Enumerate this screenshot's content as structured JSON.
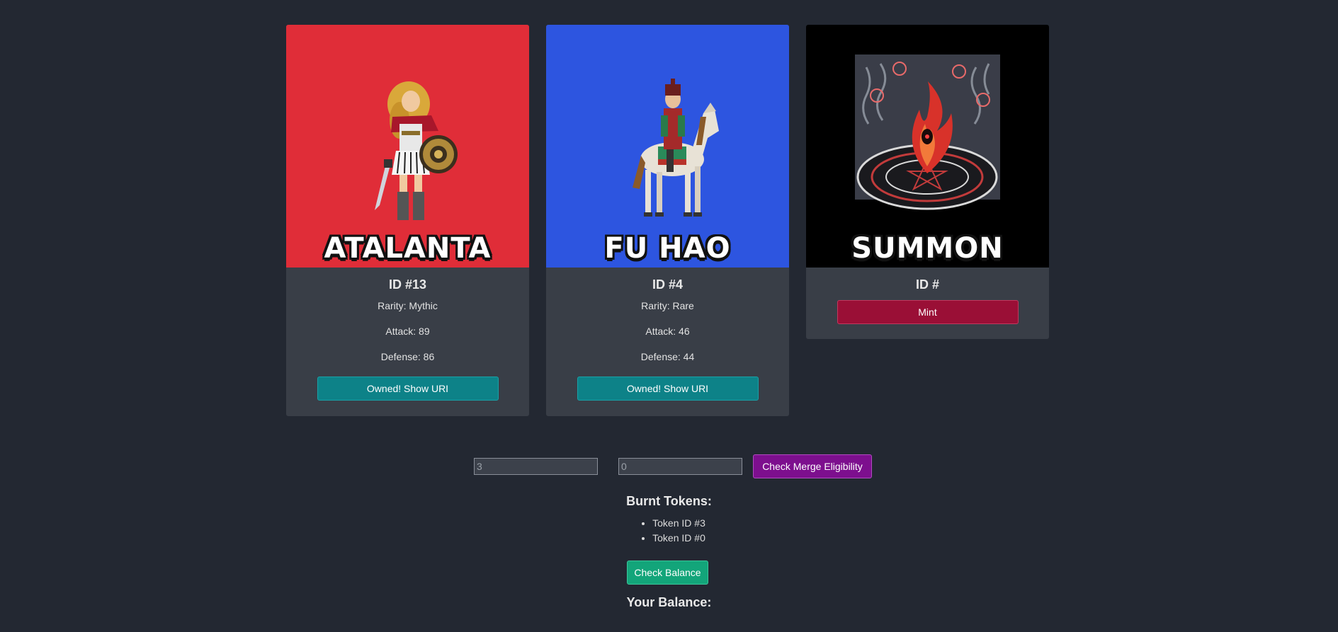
{
  "cards": [
    {
      "art_title": "ATALANTA",
      "art_bg": "#e02d38",
      "id_text": "ID #13",
      "rarity": "Rarity: Mythic",
      "attack": "Attack: 89",
      "defense": "Defense: 86",
      "button_label": "Owned! Show URI"
    },
    {
      "art_title": "FU HAO",
      "art_bg": "#2d55e0",
      "id_text": "ID #4",
      "rarity": "Rarity: Rare",
      "attack": "Attack: 46",
      "defense": "Defense: 44",
      "button_label": "Owned! Show URI"
    },
    {
      "art_title": "SUMMON",
      "art_bg": "#000000",
      "id_text": "ID #",
      "button_label": "Mint"
    }
  ],
  "merge": {
    "input1_value": "3",
    "input2_value": "0",
    "button_label": "Check Merge Eligibility"
  },
  "burnt": {
    "heading": "Burnt Tokens:",
    "items": [
      "Token ID #3",
      "Token ID #0"
    ]
  },
  "balance": {
    "button_label": "Check Balance",
    "label": "Your Balance:"
  },
  "colors": {
    "page_bg": "#232832",
    "card_bg": "#393e47",
    "owned_button": "#0d8288",
    "mint_button": "#9a0f36",
    "merge_button": "#7d0f8e",
    "balance_button": "#13a57a"
  }
}
